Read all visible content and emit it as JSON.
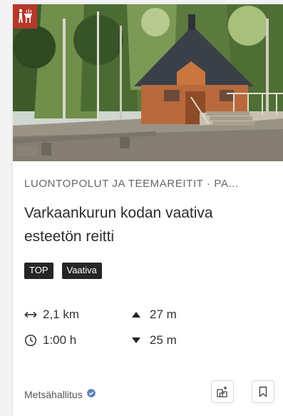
{
  "card": {
    "category": "LUONTOPOLUT JA TEEMAREITIT · PA...",
    "title": "Varkaankurun kodan vaativa esteetön reitti",
    "tags": [
      "TOP",
      "Vaativa"
    ],
    "stats": {
      "distance": "2,1 km",
      "ascent": "27 m",
      "duration": "1:00 h",
      "descent": "25 m"
    },
    "owner": "Metsähallitus",
    "category_badge_icon": "hiker-grill-icon",
    "colors": {
      "category_badge": "#b5382b",
      "tag_bg": "#262626",
      "verified": "#5a7fb8"
    }
  }
}
